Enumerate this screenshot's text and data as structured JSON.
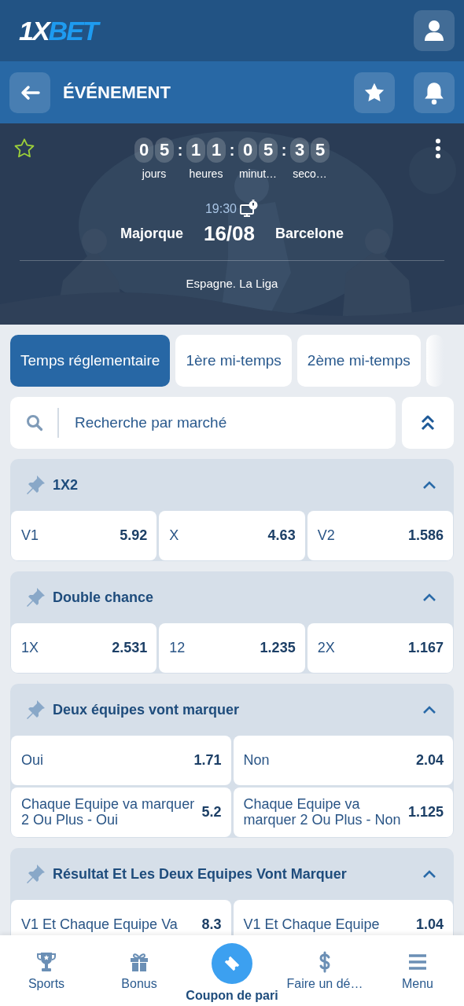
{
  "header": {
    "logo": {
      "part1": "1X",
      "part2": "BET"
    }
  },
  "subheader": {
    "title": "ÉVÉNEMENT"
  },
  "event": {
    "favorite": false,
    "countdown": [
      {
        "digits": [
          "0",
          "5"
        ],
        "unit": "jours"
      },
      {
        "separator": ":",
        "digits": [
          "1",
          "1"
        ],
        "unit": "heures"
      },
      {
        "separator": ":",
        "digits": [
          "0",
          "5"
        ],
        "unit": "minut…"
      },
      {
        "separator": ":",
        "digits": [
          "3",
          "5"
        ],
        "unit": "seco…"
      }
    ],
    "time": "19:30",
    "home": "Majorque",
    "date": "16/08",
    "away": "Barcelone",
    "league": "Espagne. La Liga"
  },
  "tabs": [
    {
      "label": "Temps réglementaire",
      "selected": true
    },
    {
      "label": "1ère mi-temps",
      "selected": false
    },
    {
      "label": "2ème mi-temps",
      "selected": false
    },
    {
      "selected": false
    }
  ],
  "search": {
    "placeholder": "Recherche par marché"
  },
  "markets": [
    {
      "title": "1X2",
      "expanded": true,
      "outcomes": [
        {
          "label": "V1",
          "odds": "5.92"
        },
        {
          "label": "X",
          "odds": "4.63"
        },
        {
          "label": "V2",
          "odds": "1.586"
        }
      ]
    },
    {
      "title": "Double chance",
      "expanded": true,
      "outcomes": [
        {
          "label": "1X",
          "odds": "2.531"
        },
        {
          "label": "12",
          "odds": "1.235"
        },
        {
          "label": "2X",
          "odds": "1.167"
        }
      ]
    },
    {
      "title": "Deux équipes vont marquer",
      "expanded": true,
      "outcomes": [
        {
          "label": "Oui",
          "odds": "1.71"
        },
        {
          "label": "Non",
          "odds": "2.04"
        },
        {
          "label": "Chaque Equipe va marquer 2 Ou Plus - Oui",
          "odds": "5.2"
        },
        {
          "label": "Chaque Equipe va marquer 2 Ou Plus - Non",
          "odds": "1.125"
        }
      ]
    },
    {
      "title": "Résultat Et Les Deux Equipes Vont Marquer",
      "expanded": true,
      "outcomes": [
        {
          "label": "V1 Et Chaque Equipe Va",
          "odds": "8.3"
        },
        {
          "label": "V1 Et Chaque Equipe",
          "odds": "1.04"
        }
      ]
    }
  ],
  "bottom_nav": [
    {
      "kind": "trophy",
      "label": "Sports",
      "selected": false
    },
    {
      "kind": "gift",
      "label": "Bonus",
      "selected": false
    },
    {
      "kind": "ticket",
      "label": "Coupon de pari",
      "selected": true
    },
    {
      "kind": "dollar",
      "label": "Faire un dé…",
      "selected": false
    },
    {
      "kind": "menu",
      "label": "Menu",
      "selected": false
    }
  ]
}
